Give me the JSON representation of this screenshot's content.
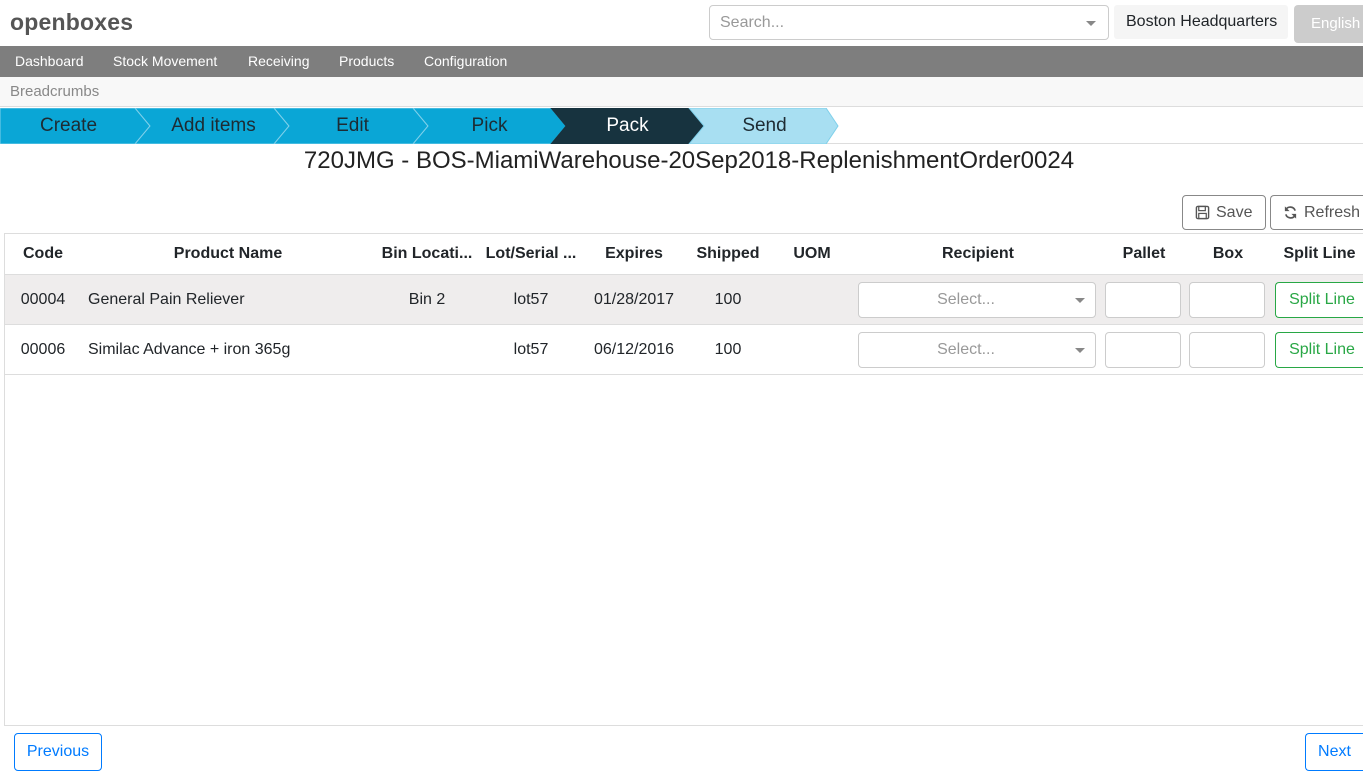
{
  "header": {
    "logo": "openboxes",
    "search_placeholder": "Search...",
    "location": "Boston Headquarters",
    "language": "English"
  },
  "nav": {
    "items": [
      "Dashboard",
      "Stock Movement",
      "Receiving",
      "Products",
      "Configuration"
    ]
  },
  "breadcrumbs_label": "Breadcrumbs",
  "wizard": {
    "steps": [
      "Create",
      "Add items",
      "Edit",
      "Pick",
      "Pack",
      "Send"
    ],
    "active_step": "Pack",
    "colors": {
      "done": "#0aa6d6",
      "active": "#17333f",
      "next": "#a8dff2"
    }
  },
  "page_title": "720JMG - BOS-MiamiWarehouse-20Sep2018-ReplenishmentOrder0024",
  "actions": {
    "save": "Save",
    "refresh": "Refresh"
  },
  "table": {
    "headers": [
      "Code",
      "Product Name",
      "Bin Locati...",
      "Lot/Serial ...",
      "Expires",
      "Shipped",
      "UOM",
      "Recipient",
      "Pallet",
      "Box",
      "Split Line"
    ],
    "rows": [
      {
        "code": "00004",
        "product": "General Pain Reliever",
        "bin": "Bin 2",
        "lot": "lot57",
        "expires": "01/28/2017",
        "shipped": "100",
        "uom": "",
        "recipient_placeholder": "Select...",
        "pallet": "",
        "box": "",
        "split": "Split Line"
      },
      {
        "code": "00006",
        "product": "Similac Advance + iron 365g",
        "bin": "",
        "lot": "lot57",
        "expires": "06/12/2016",
        "shipped": "100",
        "uom": "",
        "recipient_placeholder": "Select...",
        "pallet": "",
        "box": "",
        "split": "Split Line"
      }
    ]
  },
  "footer": {
    "previous": "Previous",
    "next": "Next"
  }
}
